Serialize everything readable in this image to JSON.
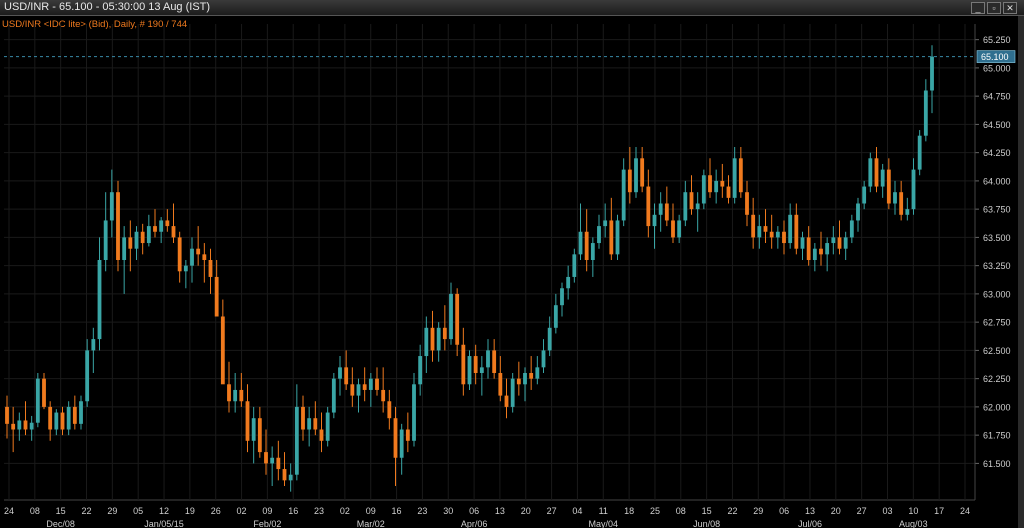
{
  "window": {
    "title": "USD/INR - 65.100 - 05:30:00  13 Aug (IST)",
    "controls": {
      "minimize": "_",
      "restore": "▫",
      "close": "✕"
    }
  },
  "colors": {
    "background": "#000000",
    "up": "#3aa6a6",
    "down": "#f07a1e",
    "grid": "#1a1a1a",
    "text": "#cfcfcf",
    "subtitle": "#f07a1e",
    "last_price_line": "#3a8aa8",
    "last_price_badge": "#2f6f8f"
  },
  "chart_data": {
    "type": "candlestick",
    "subtitle": "USD/INR <IDC lite> (Bid), Daily, # 190 / 744",
    "last_price": 65.1,
    "last_price_label": "65.100",
    "ylim": [
      61.3,
      65.3
    ],
    "y_ticks": [
      "65.250",
      "65.000",
      "64.750",
      "64.500",
      "64.250",
      "64.000",
      "63.750",
      "63.500",
      "63.250",
      "63.000",
      "62.750",
      "62.500",
      "62.250",
      "62.000",
      "61.750",
      "61.500"
    ],
    "x_day_ticks": [
      "24",
      "08",
      "15",
      "22",
      "29",
      "05",
      "12",
      "19",
      "26",
      "02",
      "09",
      "16",
      "23",
      "02",
      "09",
      "16",
      "23",
      "30",
      "06",
      "13",
      "20",
      "27",
      "04",
      "11",
      "18",
      "25",
      "08",
      "15",
      "22",
      "29",
      "06",
      "13",
      "20",
      "27",
      "03",
      "10",
      "17",
      "24"
    ],
    "x_month_ticks": [
      "Dec/08",
      "Jan/05/15",
      "Feb/02",
      "Mar/02",
      "Apr/06",
      "May/04",
      "Jun/08",
      "Jul/06",
      "Aug/03"
    ],
    "candles": [
      [
        62.0,
        62.1,
        61.72,
        61.85
      ],
      [
        61.85,
        62.0,
        61.6,
        61.8
      ],
      [
        61.8,
        61.95,
        61.7,
        61.88
      ],
      [
        61.88,
        62.05,
        61.75,
        61.8
      ],
      [
        61.8,
        61.92,
        61.7,
        61.86
      ],
      [
        61.86,
        62.3,
        61.82,
        62.25
      ],
      [
        62.25,
        62.3,
        61.98,
        62.0
      ],
      [
        62.0,
        62.05,
        61.7,
        61.8
      ],
      [
        61.8,
        61.98,
        61.75,
        61.95
      ],
      [
        61.95,
        62.0,
        61.75,
        61.8
      ],
      [
        61.8,
        62.05,
        61.75,
        62.0
      ],
      [
        62.0,
        62.1,
        61.8,
        61.85
      ],
      [
        61.85,
        62.1,
        61.8,
        62.05
      ],
      [
        62.05,
        62.6,
        62.0,
        62.5
      ],
      [
        62.5,
        62.7,
        62.3,
        62.6
      ],
      [
        62.6,
        63.5,
        62.5,
        63.3
      ],
      [
        63.3,
        63.9,
        63.2,
        63.65
      ],
      [
        63.65,
        64.1,
        63.5,
        63.9
      ],
      [
        63.9,
        64.0,
        63.2,
        63.3
      ],
      [
        63.3,
        63.6,
        63.0,
        63.5
      ],
      [
        63.5,
        63.65,
        63.2,
        63.4
      ],
      [
        63.4,
        63.6,
        63.3,
        63.55
      ],
      [
        63.55,
        63.62,
        63.35,
        63.45
      ],
      [
        63.45,
        63.7,
        63.42,
        63.6
      ],
      [
        63.6,
        63.75,
        63.5,
        63.55
      ],
      [
        63.55,
        63.68,
        63.45,
        63.65
      ],
      [
        63.65,
        63.75,
        63.55,
        63.6
      ],
      [
        63.6,
        63.8,
        63.45,
        63.5
      ],
      [
        63.5,
        63.55,
        63.1,
        63.2
      ],
      [
        63.2,
        63.3,
        63.05,
        63.25
      ],
      [
        63.25,
        63.5,
        63.1,
        63.4
      ],
      [
        63.4,
        63.6,
        63.25,
        63.35
      ],
      [
        63.35,
        63.45,
        63.1,
        63.3
      ],
      [
        63.3,
        63.4,
        63.0,
        63.15
      ],
      [
        63.15,
        63.3,
        62.9,
        62.8
      ],
      [
        62.8,
        62.95,
        62.4,
        62.2
      ],
      [
        62.2,
        62.4,
        61.95,
        62.05
      ],
      [
        62.05,
        62.3,
        61.95,
        62.15
      ],
      [
        62.15,
        62.3,
        62.0,
        62.05
      ],
      [
        62.05,
        62.2,
        61.6,
        61.7
      ],
      [
        61.7,
        62.0,
        61.5,
        61.9
      ],
      [
        61.9,
        62.0,
        61.55,
        61.6
      ],
      [
        61.6,
        61.8,
        61.4,
        61.5
      ],
      [
        61.5,
        61.65,
        61.3,
        61.55
      ],
      [
        61.55,
        61.7,
        61.35,
        61.45
      ],
      [
        61.45,
        61.6,
        61.3,
        61.35
      ],
      [
        61.35,
        61.5,
        61.25,
        61.4
      ],
      [
        61.4,
        62.2,
        61.35,
        62.0
      ],
      [
        62.0,
        62.1,
        61.7,
        61.8
      ],
      [
        61.8,
        62.0,
        61.65,
        61.9
      ],
      [
        61.9,
        62.05,
        61.75,
        61.8
      ],
      [
        61.8,
        61.95,
        61.6,
        61.7
      ],
      [
        61.7,
        62.0,
        61.65,
        61.95
      ],
      [
        61.95,
        62.3,
        61.9,
        62.25
      ],
      [
        62.25,
        62.45,
        62.1,
        62.35
      ],
      [
        62.35,
        62.5,
        62.15,
        62.2
      ],
      [
        62.2,
        62.35,
        62.0,
        62.1
      ],
      [
        62.1,
        62.25,
        61.95,
        62.2
      ],
      [
        62.2,
        62.35,
        62.05,
        62.15
      ],
      [
        62.15,
        62.3,
        62.0,
        62.25
      ],
      [
        62.25,
        62.35,
        62.1,
        62.15
      ],
      [
        62.15,
        62.35,
        61.95,
        62.05
      ],
      [
        62.05,
        62.15,
        61.8,
        61.9
      ],
      [
        61.9,
        62.0,
        61.3,
        61.55
      ],
      [
        61.55,
        61.85,
        61.4,
        61.8
      ],
      [
        61.8,
        61.95,
        61.6,
        61.7
      ],
      [
        61.7,
        62.3,
        61.65,
        62.2
      ],
      [
        62.2,
        62.55,
        62.1,
        62.45
      ],
      [
        62.45,
        62.8,
        62.3,
        62.7
      ],
      [
        62.7,
        62.85,
        62.4,
        62.5
      ],
      [
        62.5,
        62.75,
        62.4,
        62.7
      ],
      [
        62.7,
        62.9,
        62.5,
        62.6
      ],
      [
        62.6,
        63.1,
        62.55,
        63.0
      ],
      [
        63.0,
        63.05,
        62.45,
        62.55
      ],
      [
        62.55,
        62.7,
        62.1,
        62.2
      ],
      [
        62.2,
        62.5,
        62.15,
        62.45
      ],
      [
        62.45,
        62.55,
        62.2,
        62.3
      ],
      [
        62.3,
        62.45,
        62.1,
        62.35
      ],
      [
        62.35,
        62.6,
        62.25,
        62.5
      ],
      [
        62.5,
        62.6,
        62.25,
        62.3
      ],
      [
        62.3,
        62.45,
        62.05,
        62.1
      ],
      [
        62.1,
        62.25,
        61.9,
        62.0
      ],
      [
        62.0,
        62.3,
        61.95,
        62.25
      ],
      [
        62.25,
        62.4,
        62.1,
        62.2
      ],
      [
        62.2,
        62.35,
        62.05,
        62.3
      ],
      [
        62.3,
        62.45,
        62.15,
        62.25
      ],
      [
        62.25,
        62.45,
        62.2,
        62.35
      ],
      [
        62.35,
        62.6,
        62.3,
        62.5
      ],
      [
        62.5,
        62.8,
        62.45,
        62.7
      ],
      [
        62.7,
        63.0,
        62.65,
        62.9
      ],
      [
        62.9,
        63.1,
        62.8,
        63.05
      ],
      [
        63.05,
        63.25,
        62.95,
        63.15
      ],
      [
        63.15,
        63.4,
        63.1,
        63.35
      ],
      [
        63.35,
        63.8,
        63.3,
        63.55
      ],
      [
        63.55,
        63.75,
        63.2,
        63.3
      ],
      [
        63.3,
        63.5,
        63.15,
        63.45
      ],
      [
        63.45,
        63.7,
        63.4,
        63.6
      ],
      [
        63.6,
        63.8,
        63.5,
        63.65
      ],
      [
        63.65,
        63.85,
        63.3,
        63.35
      ],
      [
        63.35,
        63.7,
        63.3,
        63.65
      ],
      [
        63.65,
        64.2,
        63.6,
        64.1
      ],
      [
        64.1,
        64.3,
        63.8,
        63.9
      ],
      [
        63.9,
        64.3,
        63.85,
        64.2
      ],
      [
        64.2,
        64.3,
        63.9,
        63.95
      ],
      [
        63.95,
        64.1,
        63.5,
        63.6
      ],
      [
        63.6,
        63.8,
        63.4,
        63.7
      ],
      [
        63.7,
        63.9,
        63.55,
        63.8
      ],
      [
        63.8,
        63.95,
        63.6,
        63.65
      ],
      [
        63.65,
        63.8,
        63.45,
        63.5
      ],
      [
        63.5,
        63.7,
        63.45,
        63.65
      ],
      [
        63.65,
        64.0,
        63.6,
        63.9
      ],
      [
        63.9,
        64.05,
        63.7,
        63.75
      ],
      [
        63.75,
        63.9,
        63.55,
        63.8
      ],
      [
        63.8,
        64.1,
        63.75,
        64.05
      ],
      [
        64.05,
        64.2,
        63.85,
        63.9
      ],
      [
        63.9,
        64.1,
        63.8,
        64.0
      ],
      [
        64.0,
        64.15,
        63.85,
        63.95
      ],
      [
        63.95,
        64.05,
        63.8,
        63.85
      ],
      [
        63.85,
        64.3,
        63.8,
        64.2
      ],
      [
        64.2,
        64.3,
        63.85,
        63.9
      ],
      [
        63.9,
        64.0,
        63.6,
        63.7
      ],
      [
        63.7,
        63.85,
        63.4,
        63.5
      ],
      [
        63.5,
        63.7,
        63.4,
        63.6
      ],
      [
        63.6,
        63.75,
        63.45,
        63.55
      ],
      [
        63.55,
        63.7,
        63.4,
        63.5
      ],
      [
        63.5,
        63.6,
        63.4,
        63.55
      ],
      [
        63.55,
        63.65,
        63.35,
        63.45
      ],
      [
        63.45,
        63.8,
        63.4,
        63.7
      ],
      [
        63.7,
        63.8,
        63.35,
        63.4
      ],
      [
        63.4,
        63.55,
        63.3,
        63.5
      ],
      [
        63.5,
        63.6,
        63.25,
        63.3
      ],
      [
        63.3,
        63.45,
        63.2,
        63.4
      ],
      [
        63.4,
        63.55,
        63.25,
        63.35
      ],
      [
        63.35,
        63.5,
        63.2,
        63.45
      ],
      [
        63.45,
        63.6,
        63.35,
        63.5
      ],
      [
        63.5,
        63.65,
        63.35,
        63.4
      ],
      [
        63.4,
        63.55,
        63.3,
        63.5
      ],
      [
        63.5,
        63.7,
        63.45,
        63.65
      ],
      [
        63.65,
        63.85,
        63.55,
        63.8
      ],
      [
        63.8,
        64.0,
        63.75,
        63.95
      ],
      [
        63.95,
        64.25,
        63.9,
        64.2
      ],
      [
        64.2,
        64.3,
        63.9,
        63.95
      ],
      [
        63.95,
        64.15,
        63.85,
        64.1
      ],
      [
        64.1,
        64.2,
        63.75,
        63.8
      ],
      [
        63.8,
        64.0,
        63.7,
        63.9
      ],
      [
        63.9,
        64.0,
        63.65,
        63.7
      ],
      [
        63.7,
        63.85,
        63.65,
        63.75
      ],
      [
        63.75,
        64.2,
        63.7,
        64.1
      ],
      [
        64.1,
        64.45,
        64.05,
        64.4
      ],
      [
        64.4,
        64.9,
        64.35,
        64.8
      ],
      [
        64.8,
        65.2,
        64.6,
        65.1
      ]
    ]
  }
}
